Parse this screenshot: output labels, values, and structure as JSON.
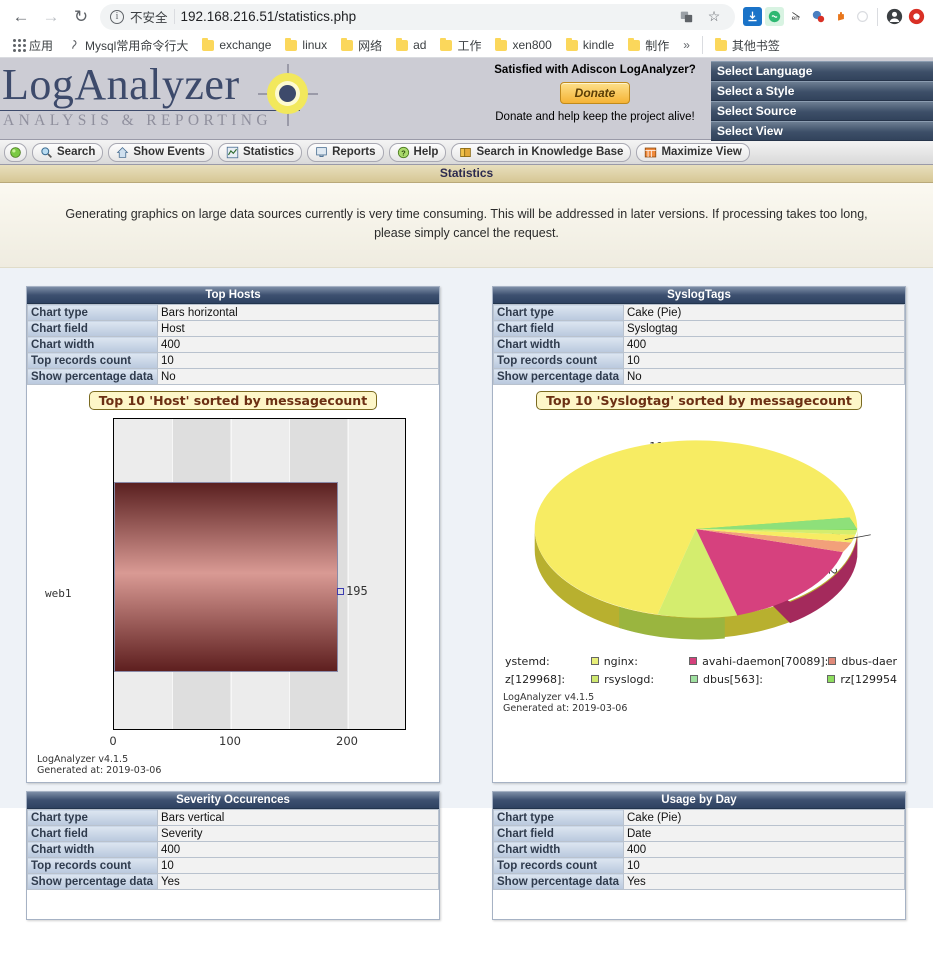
{
  "browser": {
    "nav": {
      "back_icon": "back-arrow-icon",
      "forward_icon": "forward-arrow-icon",
      "reload_icon": "reload-icon"
    },
    "omnibox": {
      "info_glyph": "i",
      "security_label": "不安全",
      "url_text": "192.168.216.51/statistics.php",
      "url_host": "192.168.216.51",
      "url_path": "/statistics.php",
      "translate_icon": "translate-icon",
      "bookmark_icon": "star-icon"
    },
    "extensions": [
      "download-icon",
      "shield-green-icon",
      "en-translate-icon",
      "antivirus-icon",
      "hand-orange-icon",
      "info-gray-icon"
    ],
    "profile_icon": "profile-avatar-icon",
    "menu_icon": "chrome-menu-icon",
    "bookmarks": [
      {
        "label": "应用",
        "icon": "apps-grid-icon"
      },
      {
        "label": "Mysql常用命令行大",
        "icon": "page-icon"
      },
      {
        "label": "exchange",
        "icon": "folder-icon"
      },
      {
        "label": "linux",
        "icon": "folder-icon"
      },
      {
        "label": "网络",
        "icon": "folder-icon"
      },
      {
        "label": "ad",
        "icon": "folder-icon"
      },
      {
        "label": "工作",
        "icon": "folder-icon"
      },
      {
        "label": "xen800",
        "icon": "folder-icon"
      },
      {
        "label": "kindle",
        "icon": "folder-icon"
      },
      {
        "label": "制作",
        "icon": "folder-icon"
      }
    ],
    "bookmarks_overflow": "»",
    "other_bookmarks": {
      "label": "其他书签",
      "icon": "folder-icon"
    }
  },
  "app": {
    "logo": {
      "title": "LogAnalyzer",
      "subtitle": "ANALYSIS & REPORTING"
    },
    "donate": {
      "question": "Satisfied with Adiscon LogAnalyzer?",
      "button_label": "Donate",
      "tagline": "Donate and help keep the project alive!"
    },
    "select_menus": [
      {
        "label": "Select Language"
      },
      {
        "label": "Select a Style"
      },
      {
        "label": "Select Source"
      },
      {
        "label": "Select View"
      }
    ],
    "toolbar": [
      {
        "label": "",
        "icon": "status-green-dot-icon"
      },
      {
        "label": "Search",
        "icon": "magnifier-icon"
      },
      {
        "label": "Show Events",
        "icon": "home-icon"
      },
      {
        "label": "Statistics",
        "icon": "chart-icon"
      },
      {
        "label": "Reports",
        "icon": "report-icon"
      },
      {
        "label": "Help",
        "icon": "help-circle-icon"
      },
      {
        "label": "Search in Knowledge Base",
        "icon": "book-icon"
      },
      {
        "label": "Maximize View",
        "icon": "maximize-icon"
      }
    ],
    "page_title": "Statistics",
    "notice": "Generating graphics on large data sources currently is very time consuming. This will be addressed in later versions. If processing takes too long, please simply cancel the request.",
    "prop_labels": {
      "chart_type": "Chart type",
      "chart_field": "Chart field",
      "chart_width": "Chart width",
      "top_records_count": "Top records count",
      "show_percentage_data": "Show percentage data"
    }
  },
  "panels": [
    {
      "title": "Top Hosts",
      "chart_type": "Bars horizontal",
      "chart_field": "Host",
      "chart_width": "400",
      "top_records_count": "10",
      "show_percentage_data": "No",
      "chart_title": "Top 10 'Host' sorted by messagecount",
      "footer_line1": "LogAnalyzer v4.1.5",
      "footer_line2": "Generated at: 2019-03-06"
    },
    {
      "title": "SyslogTags",
      "chart_type": "Cake (Pie)",
      "chart_field": "Syslogtag",
      "chart_width": "400",
      "top_records_count": "10",
      "show_percentage_data": "No",
      "chart_title": "Top 10 'Syslogtag' sorted by messagecount",
      "footer_line1": "LogAnalyzer v4.1.5",
      "footer_line2": "Generated at: 2019-03-06"
    },
    {
      "title": "Severity Occurences",
      "chart_type": "Bars vertical",
      "chart_field": "Severity",
      "chart_width": "400",
      "top_records_count": "10",
      "show_percentage_data": "Yes"
    },
    {
      "title": "Usage by Day",
      "chart_type": "Cake (Pie)",
      "chart_field": "Date",
      "chart_width": "400",
      "top_records_count": "10",
      "show_percentage_data": "Yes"
    }
  ],
  "chart_data": [
    {
      "type": "bar",
      "orientation": "horizontal",
      "title": "Top 10 'Host' sorted by messagecount",
      "categories": [
        "web1"
      ],
      "values": [
        195
      ],
      "data_labels": [
        "195"
      ],
      "xlabel": "",
      "ylabel": "",
      "xticks": [
        "0",
        "100",
        "200"
      ],
      "xtick_values": [
        0,
        100,
        200
      ],
      "xlim": [
        0,
        260
      ],
      "grid": true,
      "legend": "none"
    },
    {
      "type": "pie",
      "title": "Top 10 'Syslogtag' sorted by messagecount",
      "labels": [
        "ystemd:",
        "nginx:",
        "avahi-daemon[70089]:",
        "dbus-daer",
        "z[129968]:",
        "rsyslogd:",
        "dbus[563]:",
        "rz[129954"
      ],
      "values": [
        118,
        38,
        30,
        2,
        2,
        1,
        1,
        1
      ],
      "visible_data_labels": [
        "118",
        "38",
        "30",
        "1",
        "2",
        "2",
        "2"
      ],
      "slice_colors": [
        "#f7ec63",
        "#d4ed6e",
        "#d6417e",
        "#7ddc5c",
        "#f7ec63",
        "#d4ed6e",
        "#8ee07a"
      ],
      "legend": "bottom",
      "legend_entries": [
        {
          "label": "ystemd:",
          "color": "#f7ec63",
          "swatch": false
        },
        {
          "label": "nginx:",
          "color": "#e8ef7a",
          "swatch": true
        },
        {
          "label": "avahi-daemon[70089]:",
          "color": "#d4407c",
          "swatch": true
        },
        {
          "label": "dbus-daer",
          "color": "#e08a7a",
          "swatch": true
        },
        {
          "label": "z[129968]:",
          "color": "#cfe870",
          "swatch": false
        },
        {
          "label": "rsyslogd:",
          "color": "#cfe870",
          "swatch": true
        },
        {
          "label": "dbus[563]:",
          "color": "#9fe0a0",
          "swatch": true
        },
        {
          "label": "rz[129954",
          "color": "#8ede5f",
          "swatch": true
        }
      ],
      "footer": "LogAnalyzer v4.1.5"
    }
  ]
}
